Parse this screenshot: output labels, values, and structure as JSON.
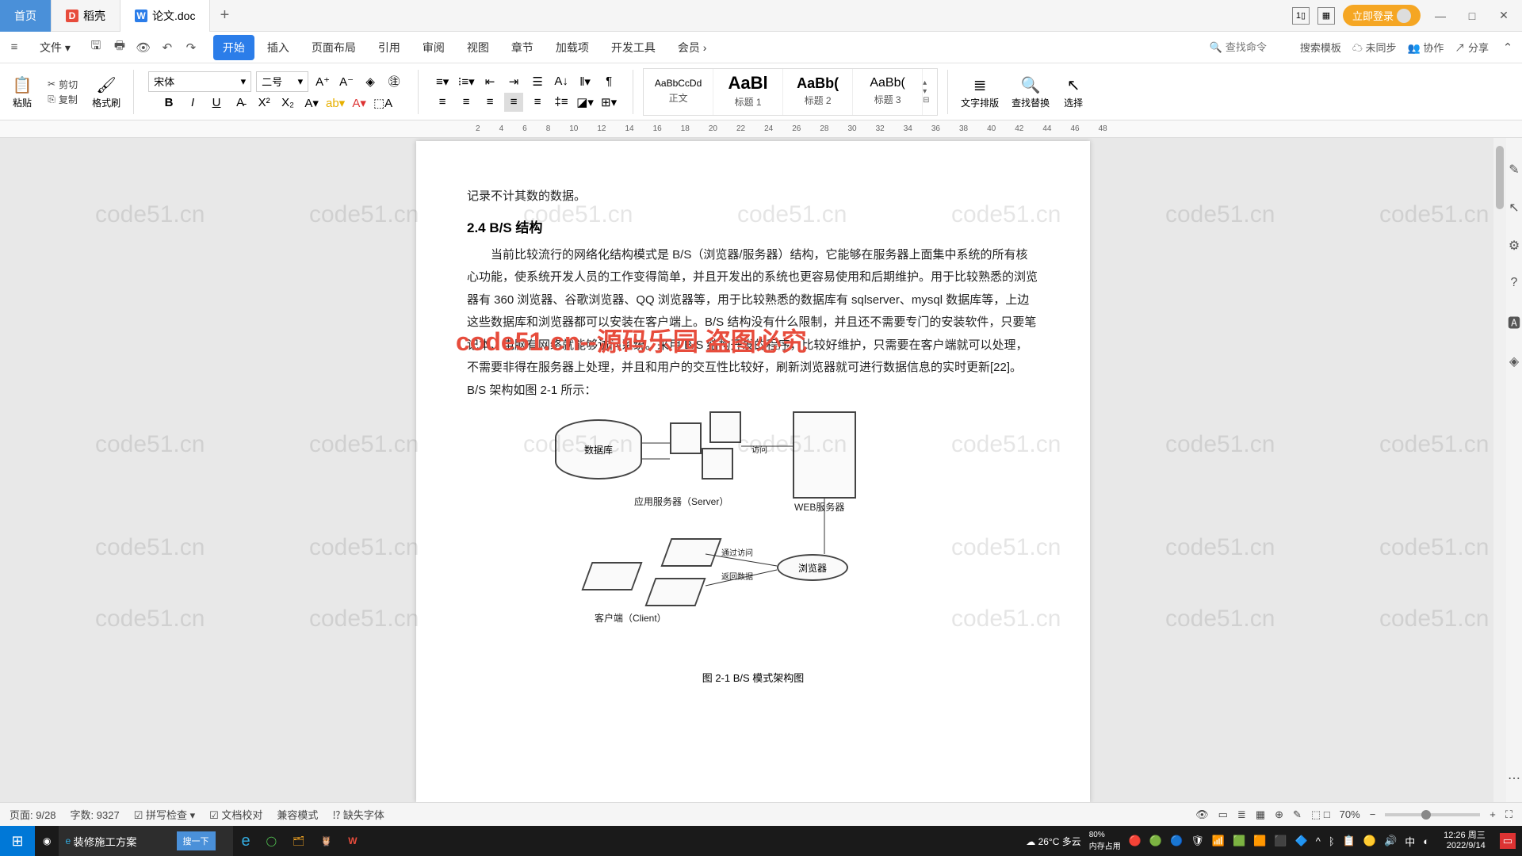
{
  "tabs": {
    "home": "首页",
    "docer": "稻壳",
    "doc": "论文.doc"
  },
  "title_right": {
    "login": "立即登录"
  },
  "menu": {
    "file": "文件",
    "items": [
      "开始",
      "插入",
      "页面布局",
      "引用",
      "审阅",
      "视图",
      "章节",
      "加载项",
      "开发工具",
      "会员"
    ],
    "search_placeholder": "查找命令",
    "template_search": "搜索模板",
    "unsync": "未同步",
    "coop": "协作",
    "share": "分享"
  },
  "ribbon": {
    "paste": "粘贴",
    "cut": "剪切",
    "copy": "复制",
    "format_painter": "格式刷",
    "font_name": "宋体",
    "font_size": "二号",
    "styles": [
      {
        "preview": "AaBbCcDd",
        "label": "正文",
        "size": "12px"
      },
      {
        "preview": "AaBl",
        "label": "标题 1",
        "size": "22px",
        "bold": true
      },
      {
        "preview": "AaBb(",
        "label": "标题 2",
        "size": "18px",
        "bold": true
      },
      {
        "preview": "AaBb(",
        "label": "标题 3",
        "size": "16px"
      }
    ],
    "text_layout": "文字排版",
    "find_replace": "查找替换",
    "select": "选择"
  },
  "ruler_marks": [
    "2",
    "4",
    "6",
    "8",
    "10",
    "12",
    "14",
    "16",
    "18",
    "20",
    "22",
    "24",
    "26",
    "28",
    "30",
    "32",
    "34",
    "36",
    "38",
    "40",
    "42",
    "44",
    "46",
    "48"
  ],
  "document": {
    "line0": "记录不计其数的数据。",
    "heading": "2.4  B/S 结构",
    "para": "当前比较流行的网络化结构模式是 B/S（浏览器/服务器）结构，它能够在服务器上面集中系统的所有核心功能，使系统开发人员的工作变得简单，并且开发出的系统也更容易使用和后期维护。用于比较熟悉的浏览器有 360 浏览器、谷歌浏览器、QQ 浏览器等，用于比较熟悉的数据库有 sqlserver、mysql 数据库等，上边这些数据库和浏览器都可以安装在客户端上。B/S 结构没有什么限制，并且还不需要专门的安装软件，只要笔记本、电脑有网络就能够访问系统。采用 B/S 结构开发的程序，比较好维护，只需要在客户端就可以处理，不需要非得在服务器上处理，并且和用户的交互性比较好，刷新浏览器就可进行数据信息的实时更新[22]。B/S 架构如图 2-1 所示：",
    "diagram": {
      "db": "数据库",
      "app_server": "应用服务器（Server）",
      "web_server": "WEB服务器",
      "browser": "浏览器",
      "client": "客户端（Client）",
      "access": "访问",
      "return": "返回",
      "via": "通过访问",
      "retdata": "返回数据"
    },
    "caption": "图 2-1  B/S 模式架构图",
    "watermark_red": "code51.cn--源码乐园 盗图必究",
    "watermark_gray": "code51.cn"
  },
  "status": {
    "page": "页面: 9/28",
    "words": "字数: 9327",
    "spell": "拼写检查",
    "proof": "文档校对",
    "compat": "兼容模式",
    "missing_font": "缺失字体",
    "zoom_pct": "70%",
    "fit": "□"
  },
  "taskbar": {
    "search_value": "装修施工方案",
    "search_btn": "搜一下",
    "weather": "26°C 多云",
    "mem": "内存占用",
    "zoom_label": "80%",
    "ime": "中",
    "time": "12:26 周三",
    "date": "2022/9/14"
  }
}
